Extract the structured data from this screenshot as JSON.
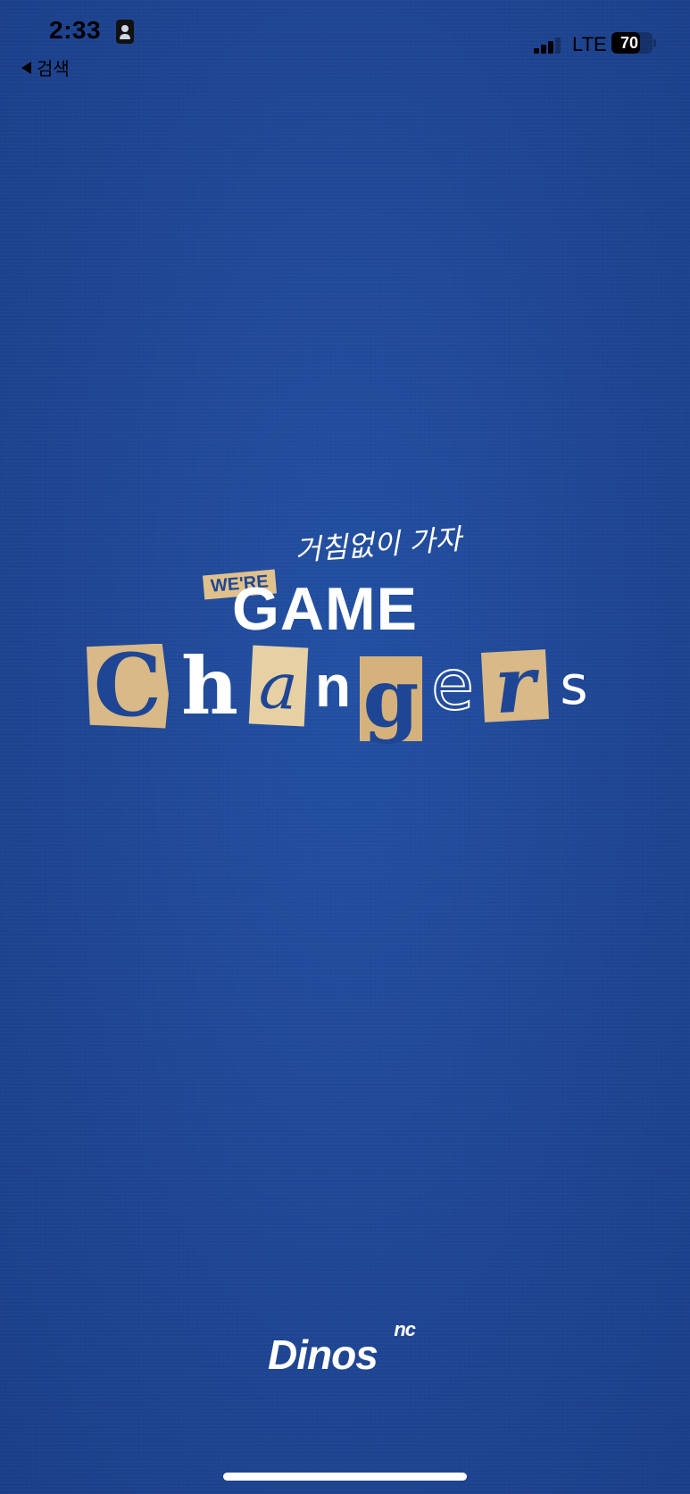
{
  "status_bar": {
    "time": "2:33",
    "back_label": "검색",
    "network": "LTE",
    "battery": "70",
    "battery_level": 0.7,
    "signal_bars_active": 3,
    "signal_bars_total": 4
  },
  "splash": {
    "slogan": "거침없이 가자",
    "were": "WE'RE",
    "game": "GAME",
    "changers_letters": [
      "C",
      "h",
      "a",
      "n",
      "g",
      "e",
      "r",
      "s"
    ],
    "brand_small": "nc",
    "brand_main": "Dinos"
  },
  "colors": {
    "background": "#1f4694",
    "paper": "#d8b987",
    "text": "#ffffff"
  },
  "icons": [
    "id-card-icon",
    "back-arrow-icon",
    "signal-icon",
    "battery-icon"
  ]
}
